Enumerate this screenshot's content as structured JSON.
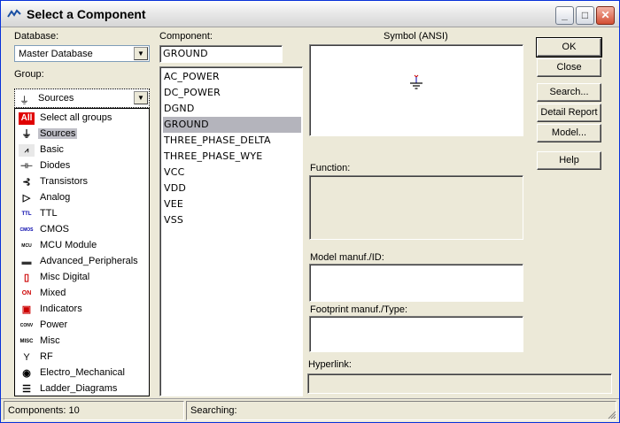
{
  "window": {
    "title": "Select a Component"
  },
  "database": {
    "label": "Database:",
    "selected": "Master Database"
  },
  "group": {
    "label": "Group:",
    "selected": "Sources",
    "items": [
      {
        "label": "Select all groups",
        "icon": "All"
      },
      {
        "label": "Sources",
        "icon": "⏚"
      },
      {
        "label": "Basic",
        "icon": "⩘"
      },
      {
        "label": "Diodes",
        "icon": "⊣⊢"
      },
      {
        "label": "Transistors",
        "icon": "⊰"
      },
      {
        "label": "Analog",
        "icon": "▷"
      },
      {
        "label": "TTL",
        "icon": "TTL"
      },
      {
        "label": "CMOS",
        "icon": "CMOS"
      },
      {
        "label": "MCU Module",
        "icon": "MCU"
      },
      {
        "label": "Advanced_Peripherals",
        "icon": "▬"
      },
      {
        "label": "Misc Digital",
        "icon": "▯"
      },
      {
        "label": "Mixed",
        "icon": "ON"
      },
      {
        "label": "Indicators",
        "icon": "▣"
      },
      {
        "label": "Power",
        "icon": "CONV"
      },
      {
        "label": "Misc",
        "icon": "MISC"
      },
      {
        "label": "RF",
        "icon": "Y"
      },
      {
        "label": "Electro_Mechanical",
        "icon": "◉"
      },
      {
        "label": "Ladder_Diagrams",
        "icon": "☰"
      }
    ]
  },
  "component": {
    "label": "Component:",
    "value": "GROUND",
    "items": [
      "AC_POWER",
      "DC_POWER",
      "DGND",
      "GROUND",
      "THREE_PHASE_DELTA",
      "THREE_PHASE_WYE",
      "VCC",
      "VDD",
      "VEE",
      "VSS"
    ],
    "selected": "GROUND"
  },
  "symbol": {
    "label": "Symbol (ANSI)"
  },
  "function": {
    "label": "Function:"
  },
  "model": {
    "label": "Model manuf./ID:"
  },
  "footprint": {
    "label": "Footprint manuf./Type:"
  },
  "hyperlink": {
    "label": "Hyperlink:"
  },
  "buttons": {
    "ok": "OK",
    "close": "Close",
    "search": "Search...",
    "detail_report": "Detail Report",
    "model": "Model...",
    "help": "Help"
  },
  "status": {
    "components": "Components: 10",
    "searching": "Searching:"
  },
  "colors": {
    "all_icon": "#e00000",
    "selection": "#b4b4bc",
    "face": "#ece9d8"
  }
}
